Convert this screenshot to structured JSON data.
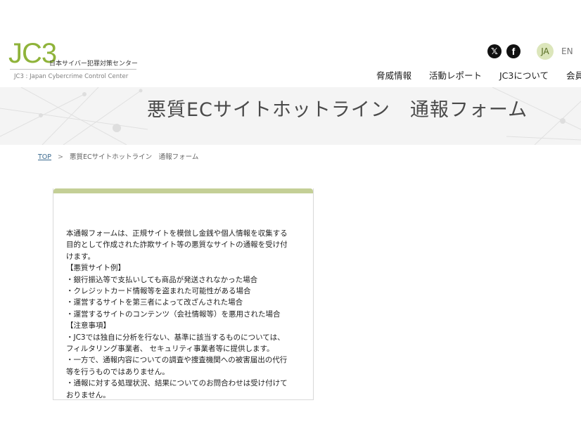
{
  "header": {
    "logo_mark": "JC3",
    "logo_sub": "日本サイバー犯罪対策センター",
    "logo_en": "JC3 : Japan Cybercrime Control Center",
    "social": [
      {
        "icon": "x-icon",
        "glyph": "𝕏"
      },
      {
        "icon": "facebook-icon",
        "glyph": "f"
      }
    ],
    "lang": {
      "active": "JA",
      "other": "EN"
    },
    "nav": [
      "脅威情報",
      "活動レポート",
      "JC3について",
      "会員"
    ]
  },
  "hero": {
    "title": "悪質ECサイトホットライン　通報フォーム"
  },
  "breadcrumb": {
    "top": "TOP",
    "separator": ">",
    "current": "悪質ECサイトホットライン　通報フォーム"
  },
  "card": {
    "accent_color": "#c4cf96",
    "lines": [
      "本通報フォームは、正規サイトを模倣し金銭や個人情報を収集する",
      "目的として作成された詐欺サイト等の悪質なサイトの通報を受け付",
      "けます。",
      "【悪質サイト例】",
      "・銀行振込等で支払いしても商品が発送されなかった場合",
      "・クレジットカード情報等を盗まれた可能性がある場合",
      "・運営するサイトを第三者によって改ざんされた場合",
      "・運営するサイトのコンテンツ（会社情報等）を悪用された場合",
      "【注意事項】",
      "・JC3では独自に分析を行ない、基準に該当するものについては、",
      "フィルタリング事業者、 セキュリティ事業者等に提供します。",
      "・一方で、通報内容についての調査や捜査機関への被害届出の代行",
      "等を行うものではありません。",
      "・通報に対する処理状況、結果についてのお問合わせは受け付けて",
      "おりません。"
    ]
  }
}
